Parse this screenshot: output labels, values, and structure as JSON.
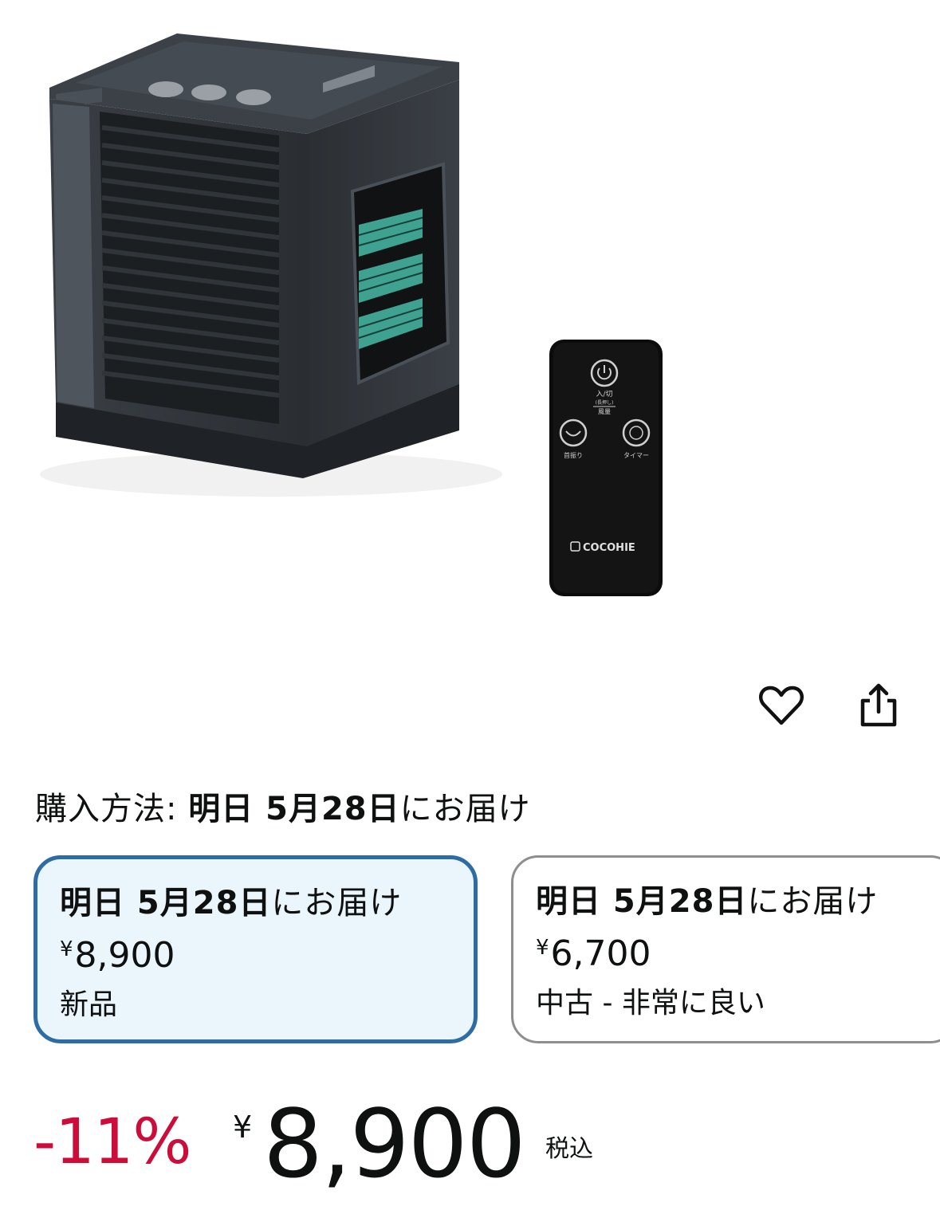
{
  "product": {
    "image_alt": "",
    "unit_brand": "COCOHIE",
    "remote_brand": "COCOHIE",
    "remote_labels": {
      "power": "入/切",
      "power_sub": "(長押し)",
      "wind": "風量",
      "swing": "首振り",
      "timer": "タイマー"
    }
  },
  "actions": {
    "wishlist_icon": "heart-outline-icon",
    "share_icon": "share-upload-icon"
  },
  "purchase": {
    "label": "購入方法: ",
    "delivery_bold": "明日 5月28日",
    "delivery_suffix": "にお届け"
  },
  "offers": [
    {
      "delivery_bold": "明日 5月28日",
      "delivery_suffix": "にお届け",
      "currency": "¥",
      "price": "8,900",
      "condition": "新品",
      "selected": true
    },
    {
      "delivery_bold": "明日 5月28日",
      "delivery_suffix": "にお届け",
      "currency": "¥",
      "price": "6,700",
      "condition": "中古 - 非常に良い",
      "selected": false
    }
  ],
  "price": {
    "discount": "-11%",
    "currency": "¥",
    "amount": "8,900",
    "tax_label": "税込"
  },
  "colors": {
    "discount_red": "#cc0c39",
    "selected_border": "#2e6da4",
    "selected_bg": "#eaf5fc",
    "unselected_border": "#8e8e8e"
  }
}
